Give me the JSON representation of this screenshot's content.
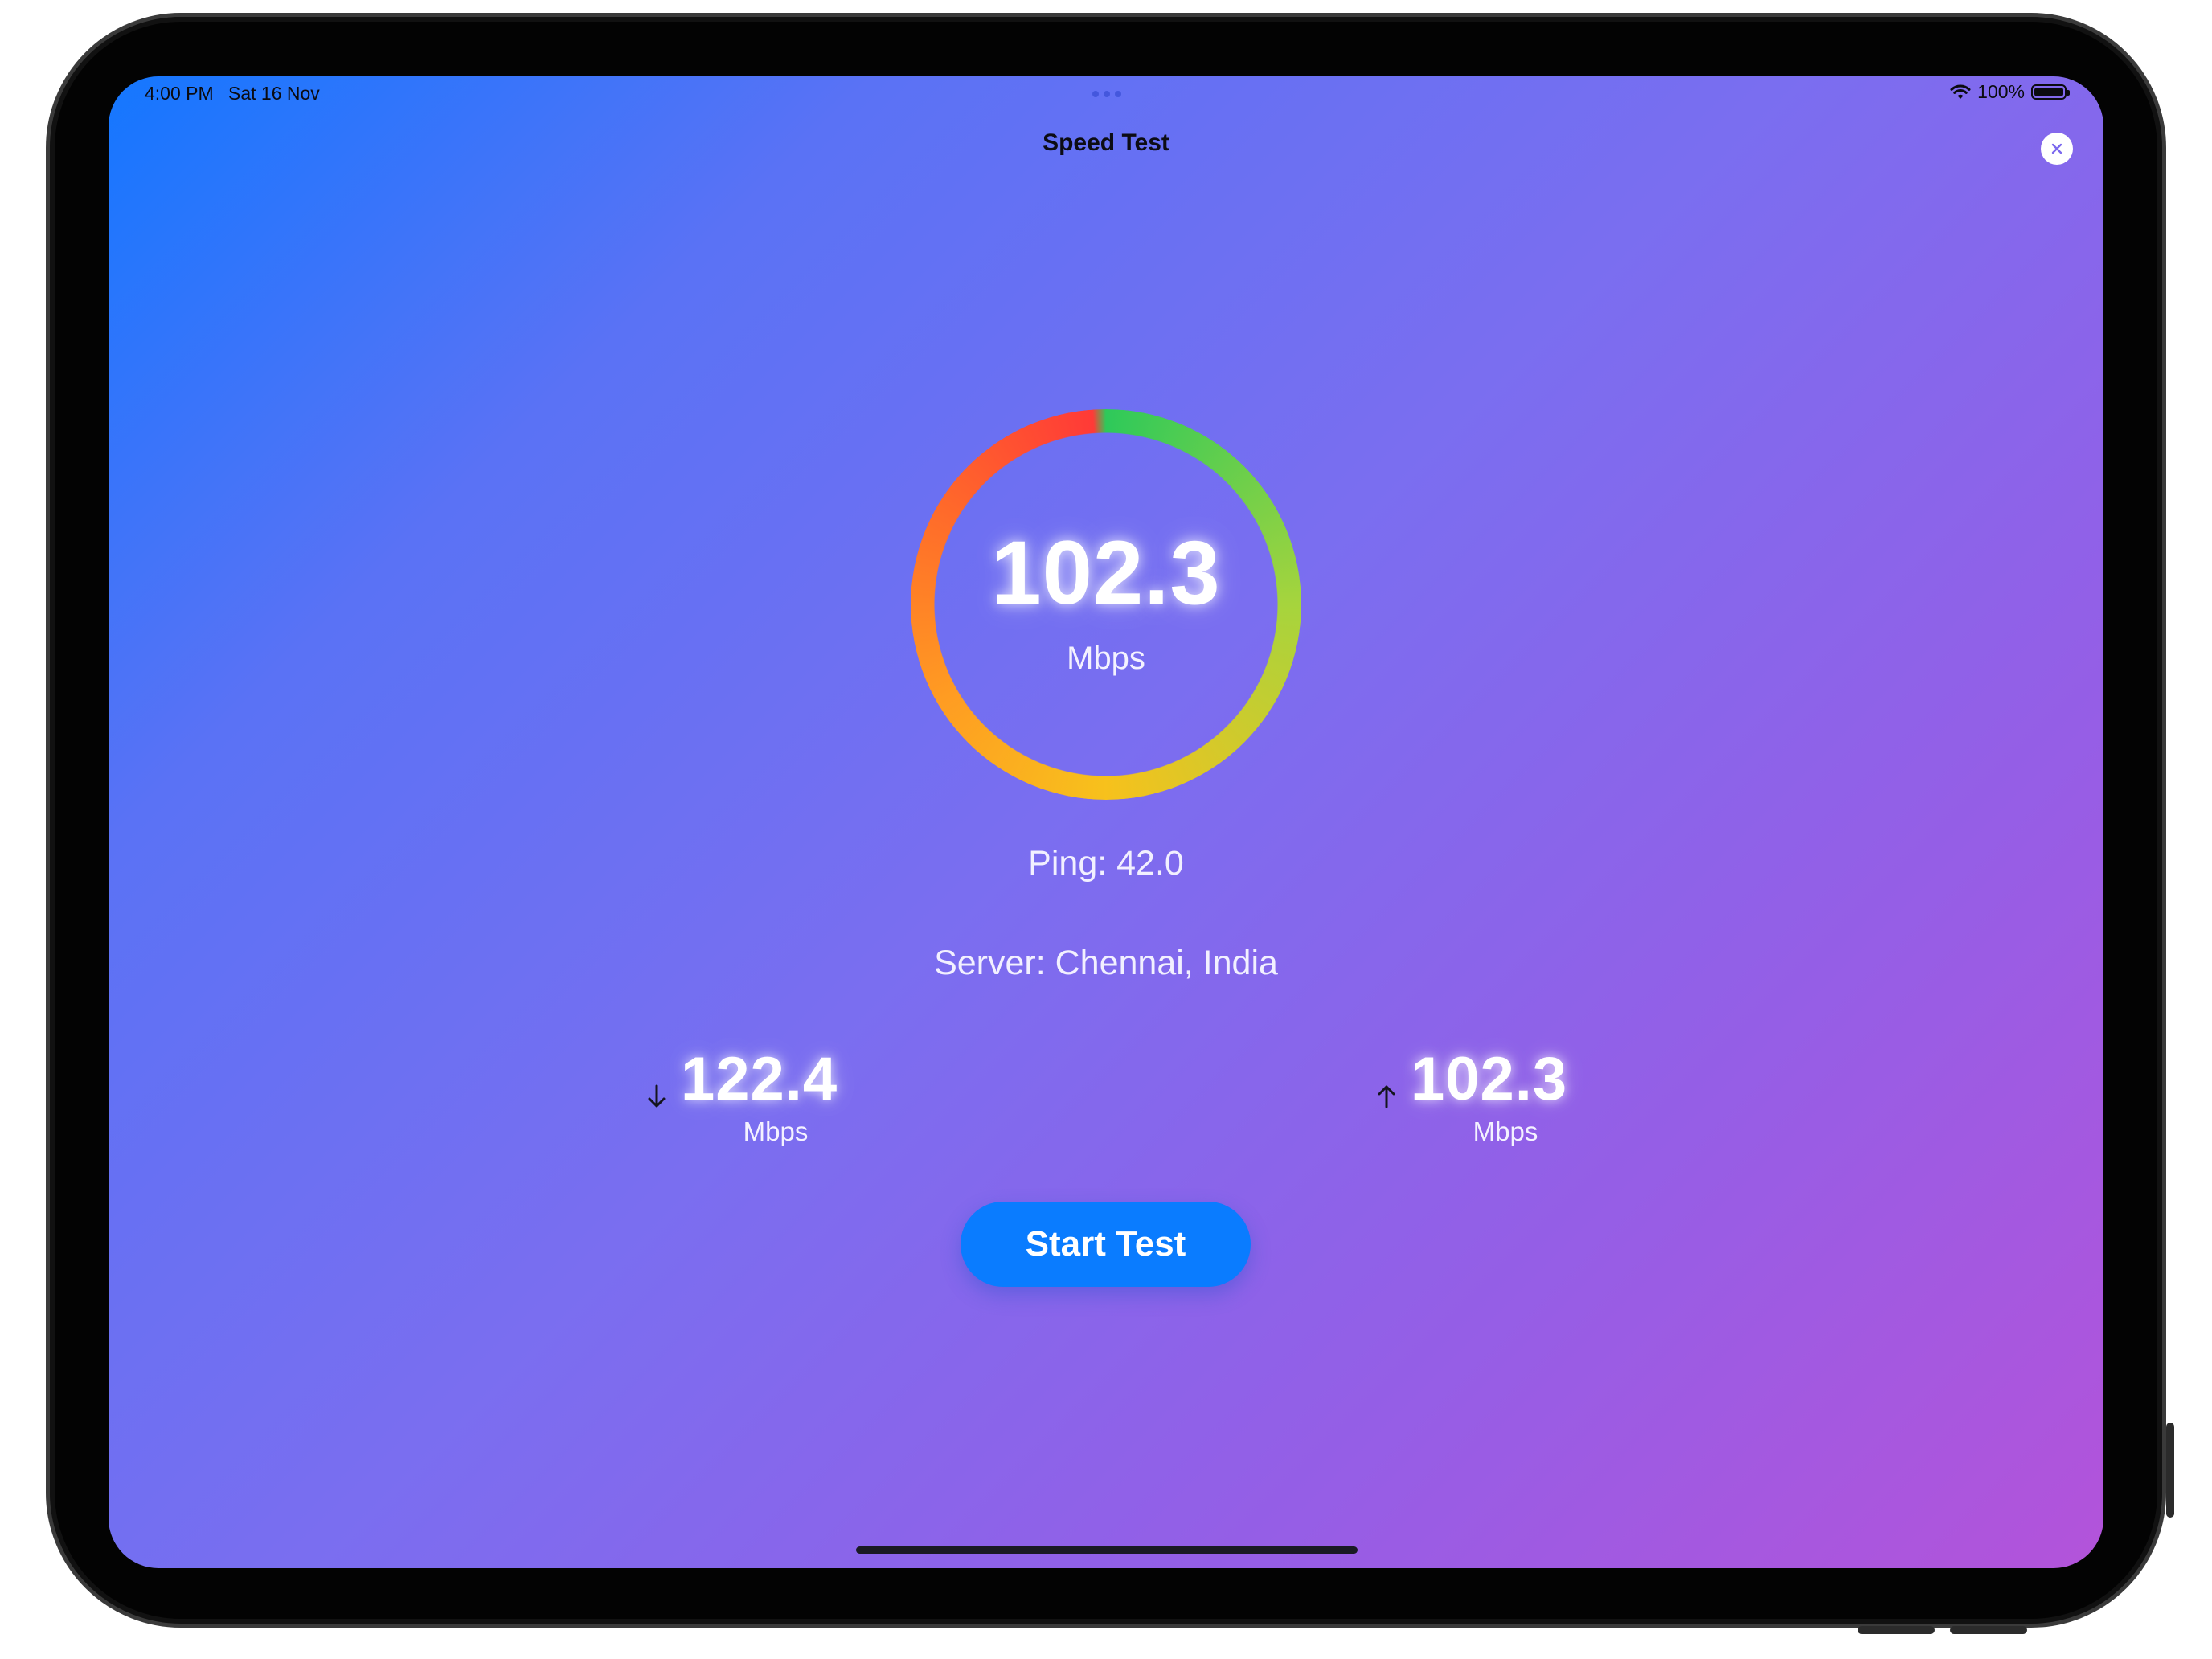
{
  "status_bar": {
    "time": "4:00 PM",
    "date": "Sat 16 Nov",
    "battery_text": "100%",
    "battery_level": 1.0
  },
  "nav": {
    "title": "Speed Test"
  },
  "gauge": {
    "value": "102.3",
    "unit": "Mbps"
  },
  "info": {
    "ping": "Ping: 42.0",
    "server": "Server: Chennai, India"
  },
  "download": {
    "value": "122.4",
    "unit": "Mbps",
    "icon": "arrow-down-icon"
  },
  "upload": {
    "value": "102.3",
    "unit": "Mbps",
    "icon": "arrow-up-icon"
  },
  "actions": {
    "start_label": "Start Test"
  },
  "colors": {
    "accent": "#0a7cff",
    "gradient_start": "#1477ff",
    "gradient_end": "#b353da",
    "ring_green": "#2ec95a",
    "ring_yellow": "#f7c11c",
    "ring_orange": "#ff9c22",
    "ring_red": "#ff3a37"
  }
}
